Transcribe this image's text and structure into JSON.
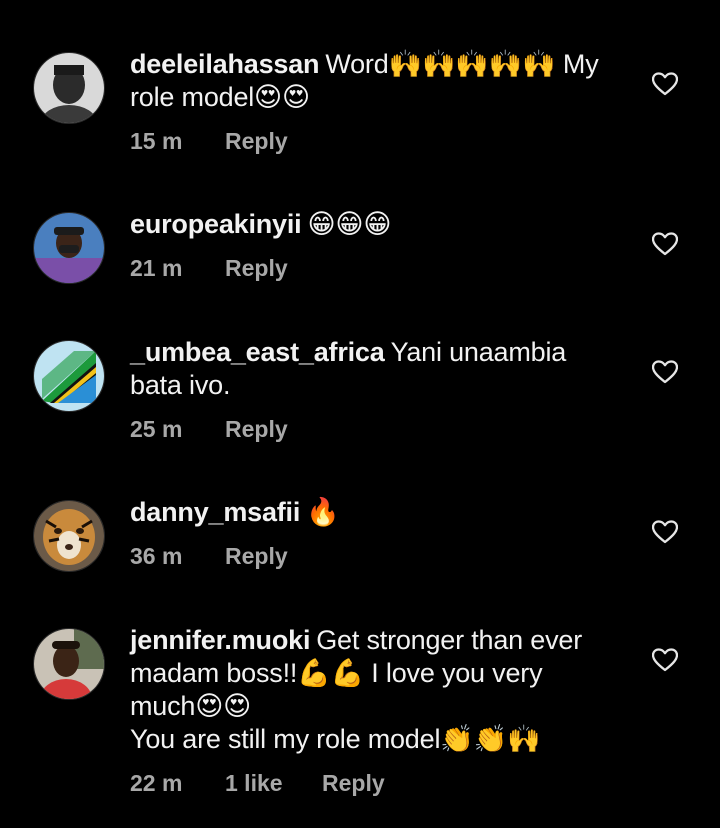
{
  "colors": {
    "background": "#000000",
    "text": "#f2f2f2",
    "meta": "#a8a8a8"
  },
  "icons": {
    "like": "heart-outline-icon"
  },
  "comments": [
    {
      "username": "deeleilahassan",
      "lines": [
        "Word🙌🙌🙌🙌🙌 My",
        "role model😍😍"
      ],
      "time": "15 m",
      "likes": "",
      "reply": "Reply"
    },
    {
      "username": "europeakinyii",
      "lines": [
        "😁😁😁"
      ],
      "time": "21 m",
      "likes": "",
      "reply": "Reply"
    },
    {
      "username": "_umbea_east_africa",
      "lines": [
        "Yani unaambia",
        "bata ivo."
      ],
      "time": "25 m",
      "likes": "",
      "reply": "Reply"
    },
    {
      "username": "danny_msafii",
      "lines": [
        "🔥"
      ],
      "time": "36 m",
      "likes": "",
      "reply": "Reply"
    },
    {
      "username": "jennifer.muoki",
      "lines": [
        "Get stronger than ever",
        "madam boss!!💪💪 I love you very",
        "much😍😍",
        "You are still my role model👏👏🙌"
      ],
      "time": "22 m",
      "likes": "1 like",
      "reply": "Reply"
    }
  ]
}
